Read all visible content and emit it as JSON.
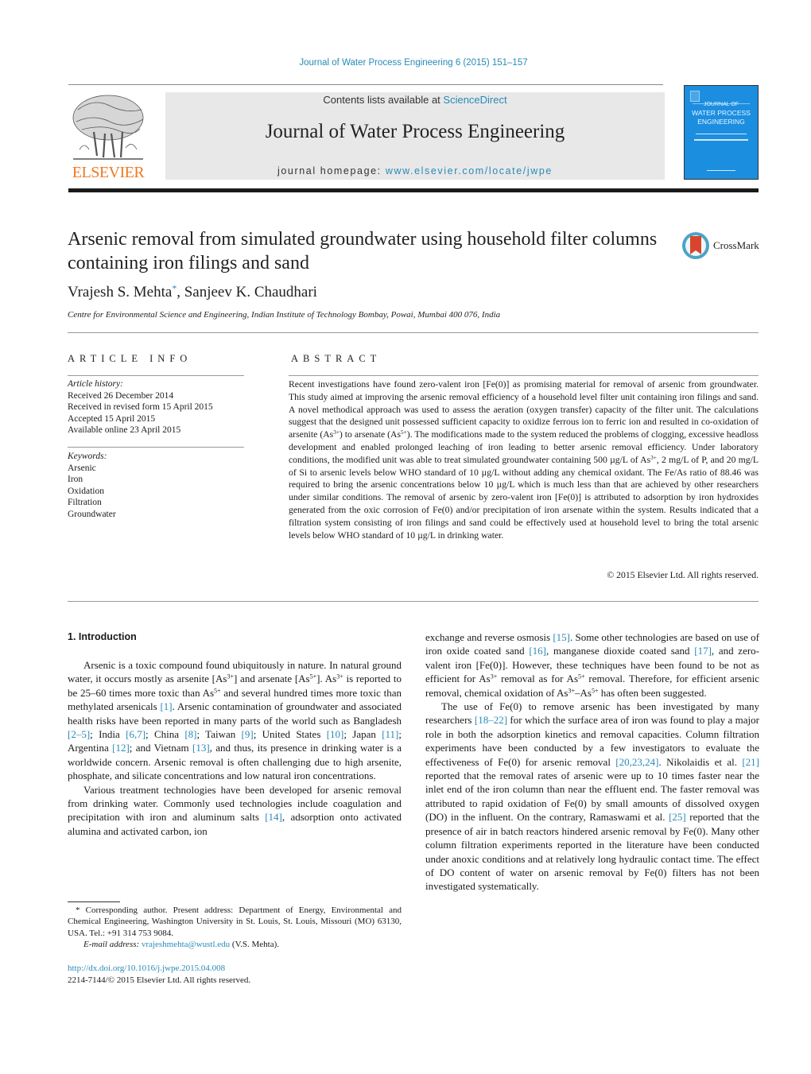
{
  "header": {
    "citation": "Journal of Water Process Engineering 6 (2015) 151–157",
    "contents_prefix": "Contents lists available at ",
    "contents_link": "ScienceDirect",
    "journal_title": "Journal of Water Process Engineering",
    "homepage_prefix": "journal homepage: ",
    "homepage_link": "www.elsevier.com/locate/jwpe",
    "publisher_logo_text": "ELSEVIER",
    "cover": {
      "line1": "JOURNAL OF",
      "line2": "WATER PROCESS",
      "line3": "ENGINEERING"
    }
  },
  "article": {
    "title": "Arsenic removal from simulated groundwater using household filter columns containing iron filings and sand",
    "crossmark_label": "CrossMark",
    "author1": "Vrajesh S. Mehta",
    "author1_mark": "*",
    "author_sep": ", ",
    "author2": "Sanjeev K. Chaudhari",
    "affiliation": "Centre for Environmental Science and Engineering, Indian Institute of Technology Bombay, Powai, Mumbai 400 076, India"
  },
  "article_info": {
    "heading": "ARTICLE INFO",
    "history_label": "Article history:",
    "history": [
      "Received 26 December 2014",
      "Received in revised form 15 April 2015",
      "Accepted 15 April 2015",
      "Available online 23 April 2015"
    ],
    "keywords_label": "Keywords:",
    "keywords": [
      "Arsenic",
      "Iron",
      "Oxidation",
      "Filtration",
      "Groundwater"
    ]
  },
  "abstract": {
    "heading": "ABSTRACT",
    "t1": "Recent investigations have found zero-valent iron [Fe(0)] as promising material for removal of arsenic from groundwater. This study aimed at improving the arsenic removal efficiency of a household level filter unit containing iron filings and sand. A novel methodical approach was used to assess the aeration (oxygen transfer) capacity of the filter unit. The calculations suggest that the designed unit possessed sufficient capacity to oxidize ferrous ion to ferric ion and resulted in co-oxidation of arsenite (As",
    "s1": "3+",
    "t2": ") to arsenate (As",
    "s2": "5+",
    "t3": "). The modifications made to the system reduced the problems of clogging, excessive headloss development and enabled prolonged leaching of iron leading to better arsenic removal efficiency. Under laboratory conditions, the modified unit was able to treat simulated groundwater containing 500 µg/L of As",
    "s3": "3+",
    "t4": ", 2 mg/L of P, and 20 mg/L of Si to arsenic levels below WHO standard of 10 µg/L without adding any chemical oxidant. The Fe/As ratio of 88.46 was required to bring the arsenic concentrations below 10 µg/L which is much less than that are achieved by other researchers under similar conditions. The removal of arsenic by zero-valent iron [Fe(0)] is attributed to adsorption by iron hydroxides generated from the oxic corrosion of Fe(0) and/or precipitation of iron arsenate within the system. Results indicated that a filtration system consisting of iron filings and sand could be effectively used at household level to bring the total arsenic levels below WHO standard of 10 µg/L in drinking water.",
    "copyright": "© 2015 Elsevier Ltd. All rights reserved."
  },
  "intro": {
    "heading": "1.  Introduction",
    "p1": {
      "a": "Arsenic is a toxic compound found ubiquitously in nature. In natural ground water, it occurs mostly as arsenite [As",
      "s1": "3+",
      "b": "] and arsenate [As",
      "s2": "5+",
      "c": "]. As",
      "s3": "3+",
      "d": " is reported to be 25–60 times more toxic than As",
      "s4": "5+",
      "e": " and several hundred times more toxic than methylated arsenicals ",
      "r1": "[1]",
      "f": ". Arsenic contamination of groundwater and associated health risks have been reported in many parts of the world such as Bangladesh ",
      "r2": "[2–5]",
      "g": "; India ",
      "r3": "[6,7]",
      "h": "; China ",
      "r4": "[8]",
      "i": "; Taiwan ",
      "r5": "[9]",
      "j": "; United States ",
      "r6": "[10]",
      "k": "; Japan ",
      "r7": "[11]",
      "l": "; Argentina ",
      "r8": "[12]",
      "m": "; and Vietnam ",
      "r9": "[13]",
      "n": ", and thus, its presence in drinking water is a worldwide concern. Arsenic removal is often challenging due to high arsenite, phosphate, and silicate concentrations and low natural iron concentrations."
    },
    "p2": {
      "a": "Various treatment technologies have been developed for arsenic removal from drinking water. Commonly used technologies include coagulation and precipitation with iron and aluminum salts ",
      "r1": "[14]",
      "b": ", adsorption onto activated alumina and activated carbon, ion"
    },
    "p2cont": {
      "a": "exchange and reverse osmosis ",
      "r1": "[15]",
      "b": ". Some other technologies are based on use of iron oxide coated sand ",
      "r2": "[16]",
      "c": ", manganese dioxide coated sand ",
      "r3": "[17]",
      "d": ", and zero-valent iron [Fe(0)]. However, these techniques have been found to be not as efficient for As",
      "s1": "3+",
      "e": " removal as for As",
      "s2": "5+",
      "f": " removal. Therefore, for efficient arsenic removal, chemical oxidation of As",
      "s3": "3+",
      "g": "–As",
      "s4": "5+",
      "h": " has often been suggested."
    },
    "p3": {
      "a": "The use of Fe(0) to remove arsenic has been investigated by many researchers ",
      "r1": "[18–22]",
      "b": " for which the surface area of iron was found to play a major role in both the adsorption kinetics and removal capacities. Column filtration experiments have been conducted by a few investigators to evaluate the effectiveness of Fe(0) for arsenic removal ",
      "r2": "[20,23,24]",
      "c": ". Nikolaidis et al. ",
      "r3": "[21]",
      "d": " reported that the removal rates of arsenic were up to 10 times faster near the inlet end of the iron column than near the effluent end. The faster removal was attributed to rapid oxidation of Fe(0) by small amounts of dissolved oxygen (DO) in the influent. On the contrary, Ramaswami et al. ",
      "r4": "[25]",
      "e": " reported that the presence of air in batch reactors hindered arsenic removal by Fe(0). Many other column filtration experiments reported in the literature have been conducted under anoxic conditions and at relatively long hydraulic contact time. The effect of DO content of water on arsenic removal by Fe(0) filters has not been investigated systematically."
    }
  },
  "footnote": {
    "corresponding": "* Corresponding author. Present address: Department of Energy, Environmental and Chemical Engineering, Washington University in St. Louis, St. Louis, Missouri (MO) 63130, USA. Tel.: +91 314 753 9084.",
    "email_label": "E-mail address: ",
    "email": "vrajeshmehta@wustl.edu",
    "email_suffix": " (V.S. Mehta).",
    "doi": "http://dx.doi.org/10.1016/j.jwpe.2015.04.008",
    "issn_copyright": "2214-7144/© 2015 Elsevier Ltd. All rights reserved."
  }
}
